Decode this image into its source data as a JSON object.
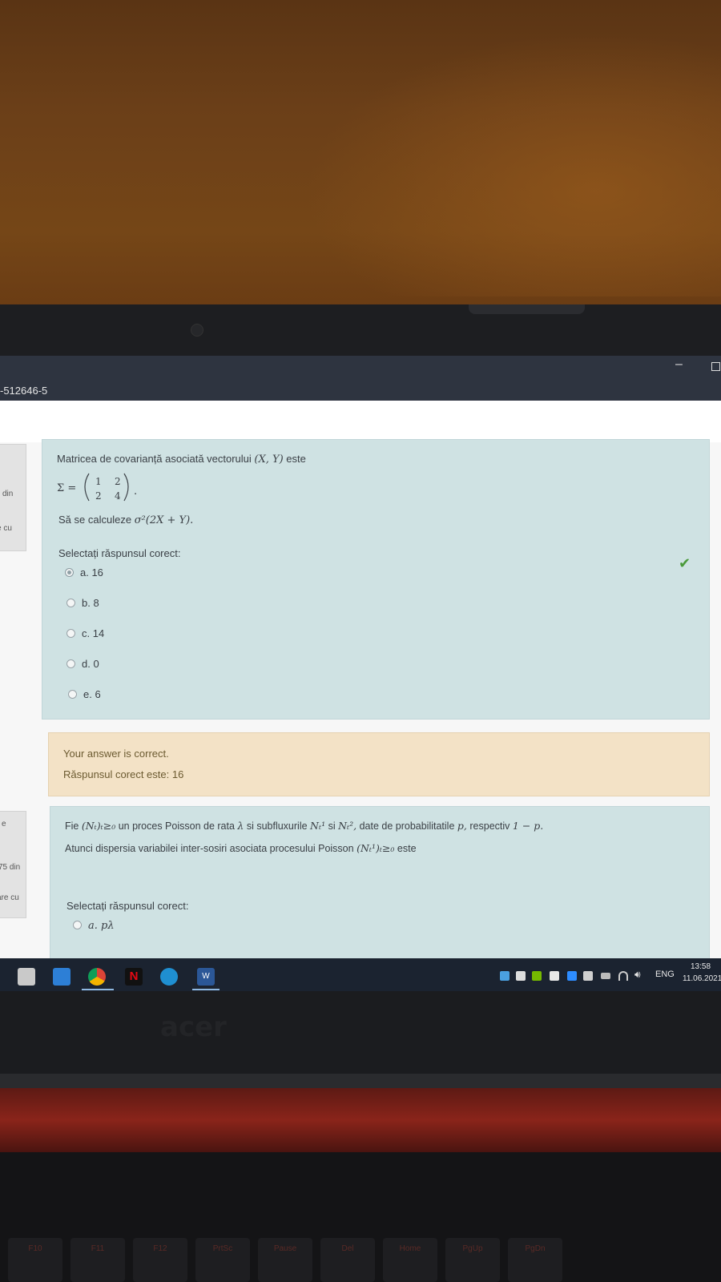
{
  "window": {
    "title": "-512646-5",
    "minimize_glyph": "–"
  },
  "sidebar": {
    "q1_din": "din",
    "q1_cu": "e cu",
    "q2_e": "e",
    "q2_din": "75 din",
    "q2_cu": "are cu"
  },
  "question1": {
    "line1_text": "Matricea de covarianță asociată vectorului",
    "line1_math": "(X, Y)",
    "line1_suffix": "este",
    "sigma": "Σ =",
    "matrix": [
      "1",
      "2",
      "2",
      "4"
    ],
    "line3_text": "Să se calculeze",
    "line3_math": "σ²(2X + Y).",
    "prompt": "Selectați răspunsul corect:",
    "options": [
      {
        "label": "a. 16",
        "selected": true
      },
      {
        "label": "b. 8",
        "selected": false
      },
      {
        "label": "c. 14",
        "selected": false
      },
      {
        "label": "d. 0",
        "selected": false
      },
      {
        "label": "e. 6",
        "selected": false
      }
    ],
    "check_icon": "✔"
  },
  "feedback": {
    "status": "Your answer is correct.",
    "correct_answer": "Răspunsul corect este: 16"
  },
  "question2": {
    "line1_a": "Fie",
    "line1_m1": "(Nₜ)ₜ≥₀",
    "line1_b": "un proces Poisson de rata",
    "line1_m2": "λ",
    "line1_c": "si subfluxurile",
    "line1_m3": "Nₜ¹",
    "line1_d": "si",
    "line1_m4": "Nₜ²,",
    "line1_e": "date de probabilitatile",
    "line1_m5": "p,",
    "line1_f": "respectiv",
    "line1_m6": "1 − p.",
    "line2_a": "Atunci dispersia variabilei inter-sosiri asociata procesului Poisson",
    "line2_m": "(Nₜ¹)ₜ≥₀",
    "line2_b": "este",
    "prompt": "Selectați răspunsul corect:",
    "option_a": "a. pλ"
  },
  "taskbar": {
    "apps": [
      "store-icon",
      "mail-icon",
      "chrome-icon",
      "netflix-icon",
      "edge-icon",
      "word-icon"
    ],
    "netflix_letter": "N",
    "word_letter": "W",
    "language": "ENG",
    "time": "13:58",
    "date": "11.06.2021",
    "volume_glyph": "🔊︎"
  },
  "laptop": {
    "brand": "acer"
  },
  "keyboard": {
    "keys": [
      "F10",
      "F11",
      "F12",
      "PrtSc",
      "Pause",
      "Del",
      "Home",
      "PgUp",
      "PgDn"
    ]
  }
}
